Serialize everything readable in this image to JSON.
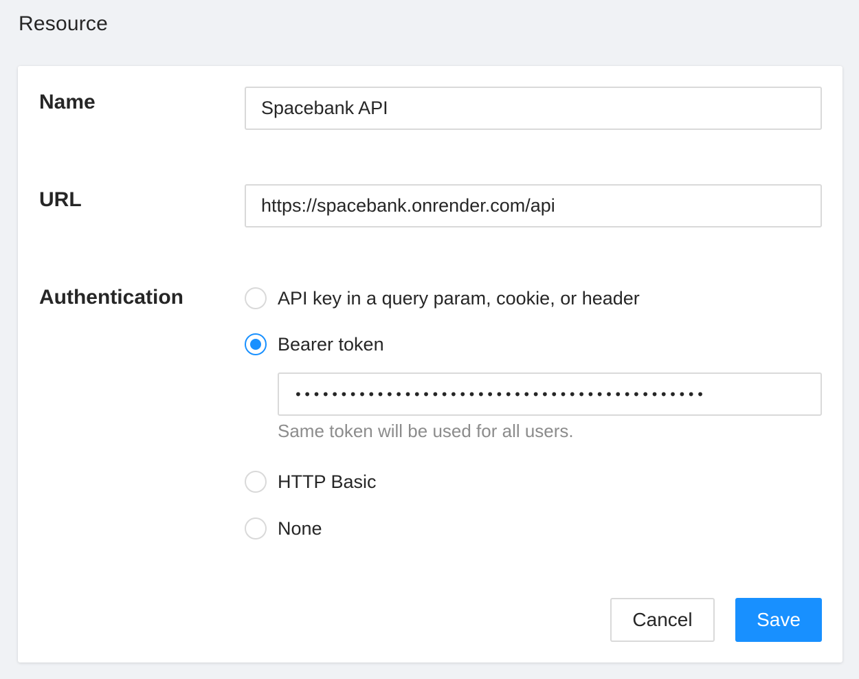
{
  "page": {
    "title": "Resource"
  },
  "form": {
    "name": {
      "label": "Name",
      "value": "Spacebank API"
    },
    "url": {
      "label": "URL",
      "value": "https://spacebank.onrender.com/api"
    },
    "authentication": {
      "label": "Authentication",
      "selected": "bearer_token",
      "options": [
        {
          "id": "api_key",
          "label": "API key in a query param, cookie, or header",
          "checked": false
        },
        {
          "id": "bearer_token",
          "label": "Bearer token",
          "checked": true
        },
        {
          "id": "http_basic",
          "label": "HTTP Basic",
          "checked": false
        },
        {
          "id": "none",
          "label": "None",
          "checked": false
        }
      ],
      "bearer_token": {
        "masked_value": "•••••••••••••••••••••••••••••••••••••••••••••",
        "help_text": "Same token will be used for all users."
      }
    }
  },
  "actions": {
    "cancel_label": "Cancel",
    "save_label": "Save"
  },
  "colors": {
    "accent": "#1890ff",
    "background": "#f0f2f5",
    "border": "#d9d9d9",
    "help_text": "#8c8c8c"
  }
}
